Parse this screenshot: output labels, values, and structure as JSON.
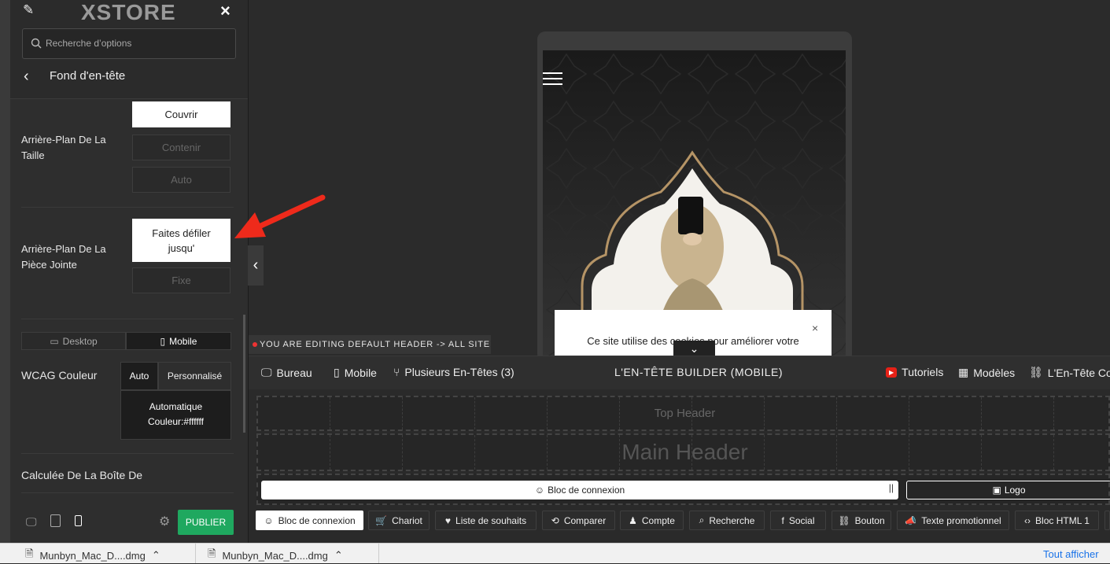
{
  "sidebar": {
    "logo": "XSTORE",
    "search_placeholder": "Recherche d’options",
    "section_title": "Fond d'en-tête",
    "bg_size": {
      "label": "Arrière-Plan De La Taille",
      "options": [
        "Couvrir",
        "Contenir",
        "Auto"
      ],
      "selected": "Couvrir"
    },
    "bg_attachment": {
      "label": "Arrière-Plan De La Pièce Jointe",
      "options": [
        "Faites défiler jusqu'",
        "Fixe"
      ],
      "selected": "Faites défiler jusqu'"
    },
    "device_tabs": [
      "Desktop",
      "Mobile"
    ],
    "wcag": {
      "label": "WCAG Couleur",
      "options": [
        "Auto",
        "Personnalisé"
      ],
      "info_line1": "Automatique",
      "info_line2": "Couleur:#ffffff"
    },
    "calc_label": "Calculée De La Boîte De",
    "publish": "PUBLIER"
  },
  "preview": {
    "cookie_text": "Ce site utilise des cookies pour améliorer votre"
  },
  "builder": {
    "editing_notice": "YOU ARE EDITING DEFAULT HEADER -> ALL SITE",
    "bar": {
      "desktop": "Bureau",
      "mobile": "Mobile",
      "multi": "Plusieurs En-Têtes (3)",
      "title": "L'EN-TÊTE BUILDER (MOBILE)",
      "tutorials": "Tutoriels",
      "models": "Modèles",
      "header_collapse": "L'En-Tête Colla"
    },
    "rows": {
      "top": "Top Header",
      "main": "Main Header"
    },
    "placed": {
      "login": "Bloc de connexion",
      "logo": "Logo"
    },
    "elements": [
      "Bloc de connexion",
      "Chariot",
      "Liste de souhaits",
      "Comparer",
      "Compte",
      "Recherche",
      "Social",
      "Bouton",
      "Texte promotionnel",
      "Bloc HTML 1"
    ]
  },
  "downloads": {
    "items": [
      "Munbyn_Mac_D....dmg",
      "Munbyn_Mac_D....dmg"
    ],
    "show_all": "Tout afficher"
  }
}
